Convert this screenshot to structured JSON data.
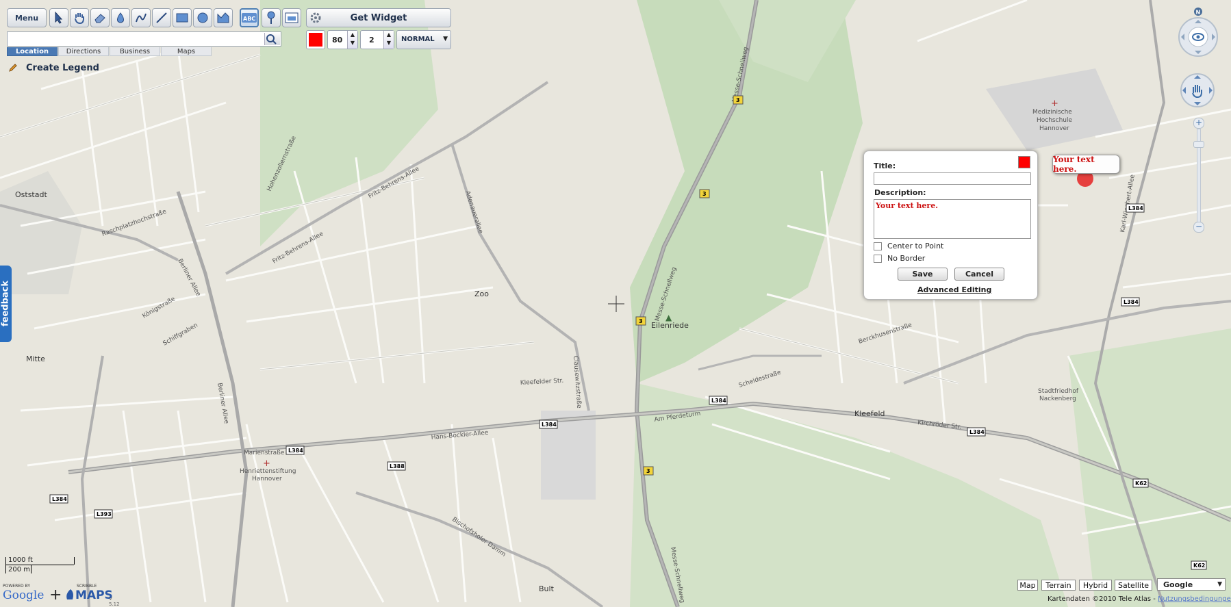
{
  "toolbar": {
    "menu_label": "Menu",
    "tools": [
      "pointer-icon",
      "hand-icon",
      "eraser-icon",
      "fill-icon",
      "freehand-icon",
      "line-icon",
      "rectangle-icon",
      "circle-icon",
      "polygon-icon",
      "text-icon",
      "marker-icon",
      "image-icon"
    ],
    "get_widget_label": "Get Widget",
    "color": "#ff0000",
    "opacity_value": "80",
    "width_value": "2",
    "mode_value": "NORMAL"
  },
  "search": {
    "placeholder": "",
    "value": ""
  },
  "tabs": [
    "Location",
    "Directions",
    "Business",
    "Maps"
  ],
  "create_legend_label": "Create Legend",
  "feedback_label": "feedback",
  "popup": {
    "title_label": "Title:",
    "title_value": "",
    "description_label": "Description:",
    "description_value": "Your text here.",
    "center_label": "Center to Point",
    "noborder_label": "No Border",
    "save_label": "Save",
    "cancel_label": "Cancel",
    "advanced_label": "Advanced Editing",
    "color": "#ff0000"
  },
  "marker_bubble": "Your text here.",
  "map_types": [
    "Map",
    "Terrain",
    "Hybrid",
    "Satellite"
  ],
  "provider_select": "Google",
  "scale": {
    "feet": "1000 ft",
    "meters": "200 m"
  },
  "branding": {
    "powered_by": "POWERED BY",
    "google": "Google",
    "scribble": "SCRIBBLE",
    "maps": "MAPS",
    "version": "V 5.12"
  },
  "copyright": "Kartendaten ©2010 Tele Atlas -",
  "terms": "Nutzungsbedingungen",
  "map_labels": {
    "places": [
      "Oststadt",
      "Mitte",
      "Zoo",
      "Eilenriede",
      "Kleefeld",
      "Bult",
      "Medizinische",
      "Hochschule",
      "Hannover",
      "Stadtfriedhof",
      "Nackenberg",
      "Henriettenstiftung",
      "Hannover"
    ],
    "streets": [
      "Messe-Schnellweg",
      "Hans-Böckler-Allee",
      "Fritz-Behrens-Allee",
      "Berliner Allee",
      "Adenauerallee",
      "Clausewitzstraße",
      "Scheidestraße",
      "Kirchröder Str.",
      "Am Pferdeturm",
      "Karl-Wiechert-Allee",
      "Bischofsholer Damm",
      "Königstraße",
      "Schiffgraben",
      "Berckhusenstraße",
      "Hohenzollernstraße",
      "Raschplatzhochstraße",
      "Marienstraße",
      "Kleefelder Str."
    ],
    "shields": [
      "3",
      "3",
      "3",
      "3",
      "L384",
      "L384",
      "L384",
      "L384",
      "L388",
      "L393",
      "L384",
      "K62",
      "K62"
    ]
  }
}
